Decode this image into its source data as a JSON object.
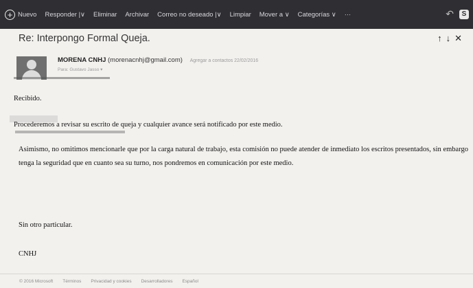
{
  "toolbar": {
    "new_label": "Nuevo",
    "reply_label": "Responder |∨",
    "delete_label": "Eliminar",
    "archive_label": "Archivar",
    "junk_label": "Correo no deseado |∨",
    "sweep_label": "Limpiar",
    "move_label": "Mover a ∨",
    "categories_label": "Categorías ∨",
    "more_label": "···"
  },
  "message": {
    "subject": "Re: Interpongo Formal Queja.",
    "sender_name": "MORENA CNHJ",
    "sender_email": "(morenacnhj@gmail.com)",
    "add_to_contacts": "Agregar a contactos 22/02/2016",
    "to_line": "Para: Gustavo Jasso ▾",
    "body": {
      "p1": "Recibido.",
      "p2": "Procederemos a revisar su escrito de queja y cualquier avance será notificado por este medio.",
      "p3": "Asimismo, no omitimos mencionarle que por la carga natural de trabajo, esta comisión no puede atender de inmediato los escritos presentados, sin embargo tenga la seguridad que en cuanto sea su turno, nos pondremos en comunicación por este medio.",
      "p4": "Sin otro particular.",
      "p5": "CNHJ"
    }
  },
  "footer": {
    "copyright": "© 2016 Microsoft",
    "terms": "Términos",
    "privacy": "Privacidad y cookies",
    "developers": "Desarrolladores",
    "language": "Español"
  },
  "colors": {
    "toolbar_bg": "#2f2f33",
    "page_bg": "#f3f1ee"
  }
}
